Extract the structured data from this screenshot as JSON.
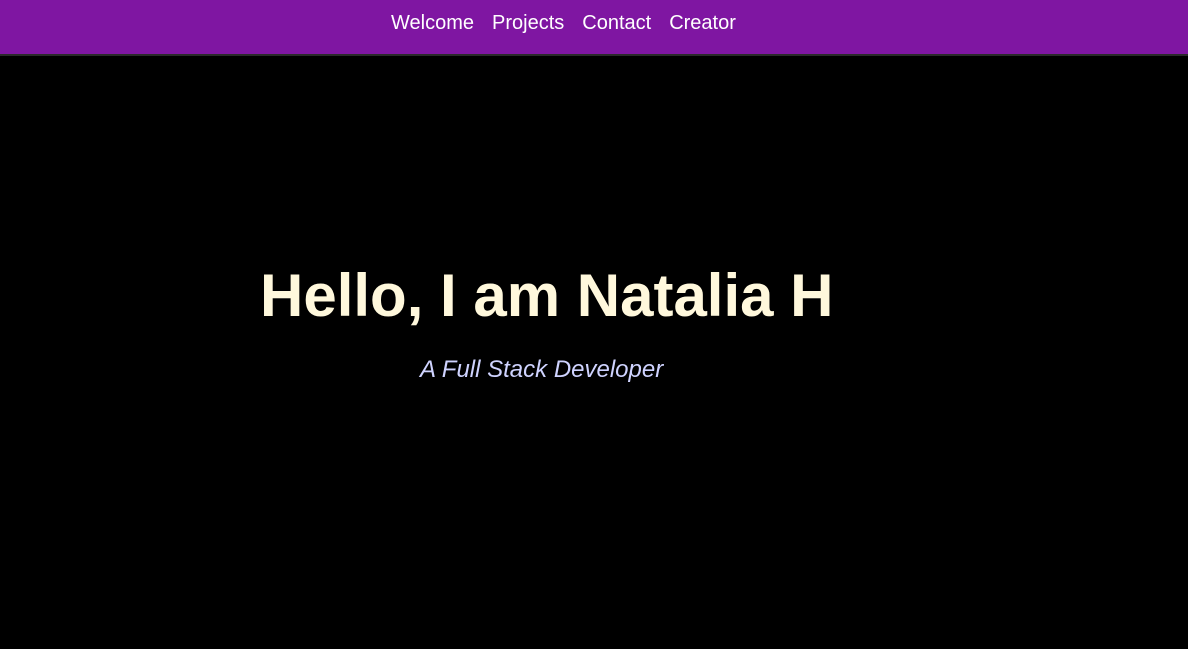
{
  "nav": {
    "items": [
      {
        "label": "Welcome"
      },
      {
        "label": "Projects"
      },
      {
        "label": "Contact"
      },
      {
        "label": "Creator"
      }
    ]
  },
  "hero": {
    "title": "Hello, I am Natalia H",
    "subtitle": "A Full Stack Developer"
  },
  "colors": {
    "navbar_background": "#7f16a2",
    "page_background": "#000000",
    "title_color": "#fff8dc",
    "subtitle_color": "#cfd3ff"
  }
}
